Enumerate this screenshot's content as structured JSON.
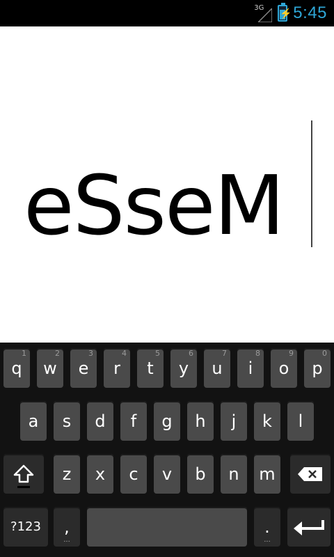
{
  "status_bar": {
    "network_type": "3G",
    "time": "5:45"
  },
  "editor": {
    "text": "eSseM"
  },
  "keyboard": {
    "row1": [
      {
        "label": "q",
        "hint": "1"
      },
      {
        "label": "w",
        "hint": "2"
      },
      {
        "label": "e",
        "hint": "3"
      },
      {
        "label": "r",
        "hint": "4"
      },
      {
        "label": "t",
        "hint": "5"
      },
      {
        "label": "y",
        "hint": "6"
      },
      {
        "label": "u",
        "hint": "7"
      },
      {
        "label": "i",
        "hint": "8"
      },
      {
        "label": "o",
        "hint": "9"
      },
      {
        "label": "p",
        "hint": "0"
      }
    ],
    "row2": [
      "a",
      "s",
      "d",
      "f",
      "g",
      "h",
      "j",
      "k",
      "l"
    ],
    "row3": [
      "z",
      "x",
      "c",
      "v",
      "b",
      "n",
      "m"
    ],
    "symbols_label": "?123",
    "comma_label": ",",
    "period_label": ".",
    "more_label": "...",
    "shift_icon": "shift-icon",
    "backspace_icon": "backspace-icon",
    "enter_icon": "enter-icon"
  }
}
